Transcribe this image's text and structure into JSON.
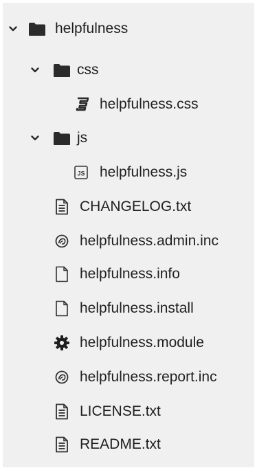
{
  "tree": {
    "root": {
      "label": "helpfulness",
      "icon": "folder-icon",
      "expanded": true,
      "children": {
        "css": {
          "label": "css",
          "icon": "folder-icon",
          "expanded": true,
          "files": [
            {
              "label": "helpfulness.css",
              "icon": "css3-icon"
            }
          ]
        },
        "js": {
          "label": "js",
          "icon": "folder-icon",
          "expanded": true,
          "files": [
            {
              "label": "helpfulness.js",
              "icon": "js-file-icon"
            }
          ]
        },
        "files": [
          {
            "label": "CHANGELOG.txt",
            "icon": "text-file-icon"
          },
          {
            "label": "helpfulness.admin.inc",
            "icon": "drupal-icon"
          },
          {
            "label": "helpfulness.info",
            "icon": "blank-file-icon"
          },
          {
            "label": "helpfulness.install",
            "icon": "blank-file-icon"
          },
          {
            "label": "helpfulness.module",
            "icon": "gear-icon"
          },
          {
            "label": "helpfulness.report.inc",
            "icon": "drupal-icon"
          },
          {
            "label": "LICENSE.txt",
            "icon": "text-file-icon"
          },
          {
            "label": "README.txt",
            "icon": "text-file-icon"
          }
        ]
      }
    }
  }
}
